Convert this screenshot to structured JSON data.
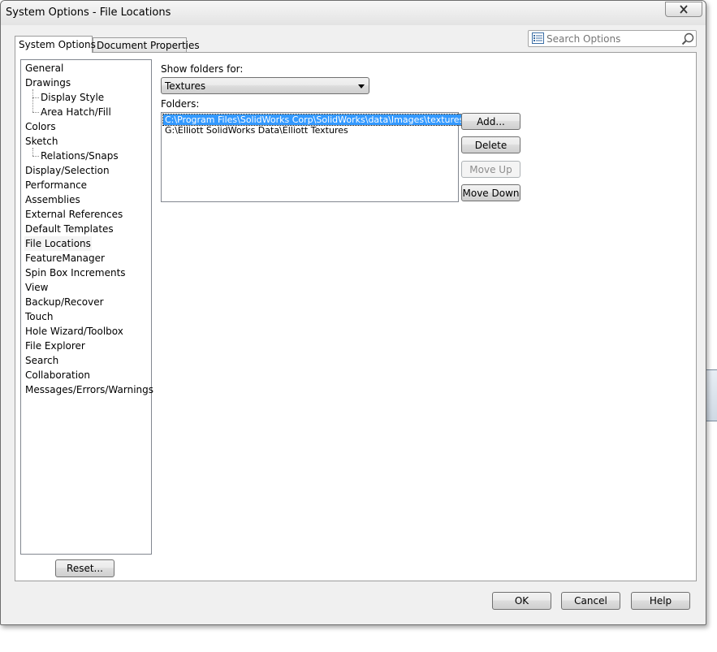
{
  "window": {
    "title": "System Options - File Locations"
  },
  "tabs": [
    {
      "label": "System Options",
      "active": true
    },
    {
      "label": "Document Properties",
      "active": false
    }
  ],
  "search": {
    "placeholder": "Search Options",
    "value": ""
  },
  "tree": {
    "items": [
      {
        "label": "General",
        "level": 0
      },
      {
        "label": "Drawings",
        "level": 0
      },
      {
        "label": "Display Style",
        "level": 1
      },
      {
        "label": "Area Hatch/Fill",
        "level": 1
      },
      {
        "label": "Colors",
        "level": 0
      },
      {
        "label": "Sketch",
        "level": 0
      },
      {
        "label": "Relations/Snaps",
        "level": 1
      },
      {
        "label": "Display/Selection",
        "level": 0
      },
      {
        "label": "Performance",
        "level": 0
      },
      {
        "label": "Assemblies",
        "level": 0
      },
      {
        "label": "External References",
        "level": 0
      },
      {
        "label": "Default Templates",
        "level": 0
      },
      {
        "label": "File Locations",
        "level": 0,
        "selected": true
      },
      {
        "label": "FeatureManager",
        "level": 0
      },
      {
        "label": "Spin Box Increments",
        "level": 0
      },
      {
        "label": "View",
        "level": 0
      },
      {
        "label": "Backup/Recover",
        "level": 0
      },
      {
        "label": "Touch",
        "level": 0
      },
      {
        "label": "Hole Wizard/Toolbox",
        "level": 0
      },
      {
        "label": "File Explorer",
        "level": 0
      },
      {
        "label": "Search",
        "level": 0
      },
      {
        "label": "Collaboration",
        "level": 0
      },
      {
        "label": "Messages/Errors/Warnings",
        "level": 0
      }
    ],
    "reset_label": "Reset..."
  },
  "main": {
    "show_folders_label": "Show folders for:",
    "show_folders_value": "Textures",
    "folders_label": "Folders:",
    "folders": [
      {
        "path": "C:\\Program Files\\SolidWorks Corp\\SolidWorks\\data\\Images\\textures",
        "selected": true
      },
      {
        "path": "G:\\Elliott SolidWorks Data\\Elliott Textures",
        "selected": false
      }
    ],
    "buttons": {
      "add": "Add...",
      "delete": "Delete",
      "move_up": "Move Up",
      "move_down": "Move Down"
    }
  },
  "footer": {
    "ok": "OK",
    "cancel": "Cancel",
    "help": "Help"
  },
  "colors": {
    "selection": "#3399ff",
    "dialog_bg": "#f0f0f0",
    "panel_bg": "#ffffff"
  }
}
